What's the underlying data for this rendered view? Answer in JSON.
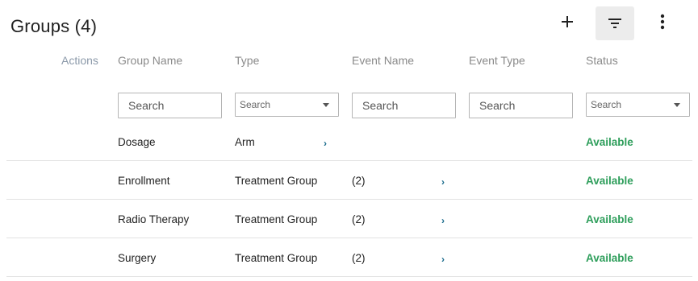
{
  "header": {
    "title": "Groups (4)"
  },
  "toolbar": {
    "add_icon": "plus-icon",
    "filter_icon": "filter-icon",
    "more_icon": "more-vertical-icon"
  },
  "columns": {
    "actions": "Actions",
    "group_name": "Group Name",
    "type": "Type",
    "event_name": "Event Name",
    "event_type": "Event Type",
    "status": "Status"
  },
  "filters": {
    "group_name_placeholder": "Search",
    "type_placeholder": "Search",
    "event_name_placeholder": "Search",
    "event_type_placeholder": "Search",
    "status_placeholder": "Search"
  },
  "rows": [
    {
      "group_name": "Dosage",
      "type": "Arm",
      "event_name": "",
      "status": "Available"
    },
    {
      "group_name": "Enrollment",
      "type": "Treatment Group",
      "event_name": "(2)",
      "status": "Available"
    },
    {
      "group_name": "Radio Therapy",
      "type": "Treatment Group",
      "event_name": "(2)",
      "status": "Available"
    },
    {
      "group_name": "Surgery",
      "type": "Treatment Group",
      "event_name": "(2)",
      "status": "Available"
    }
  ],
  "colors": {
    "status_available": "#2e9e5b",
    "chevron": "#1a6b8c"
  }
}
